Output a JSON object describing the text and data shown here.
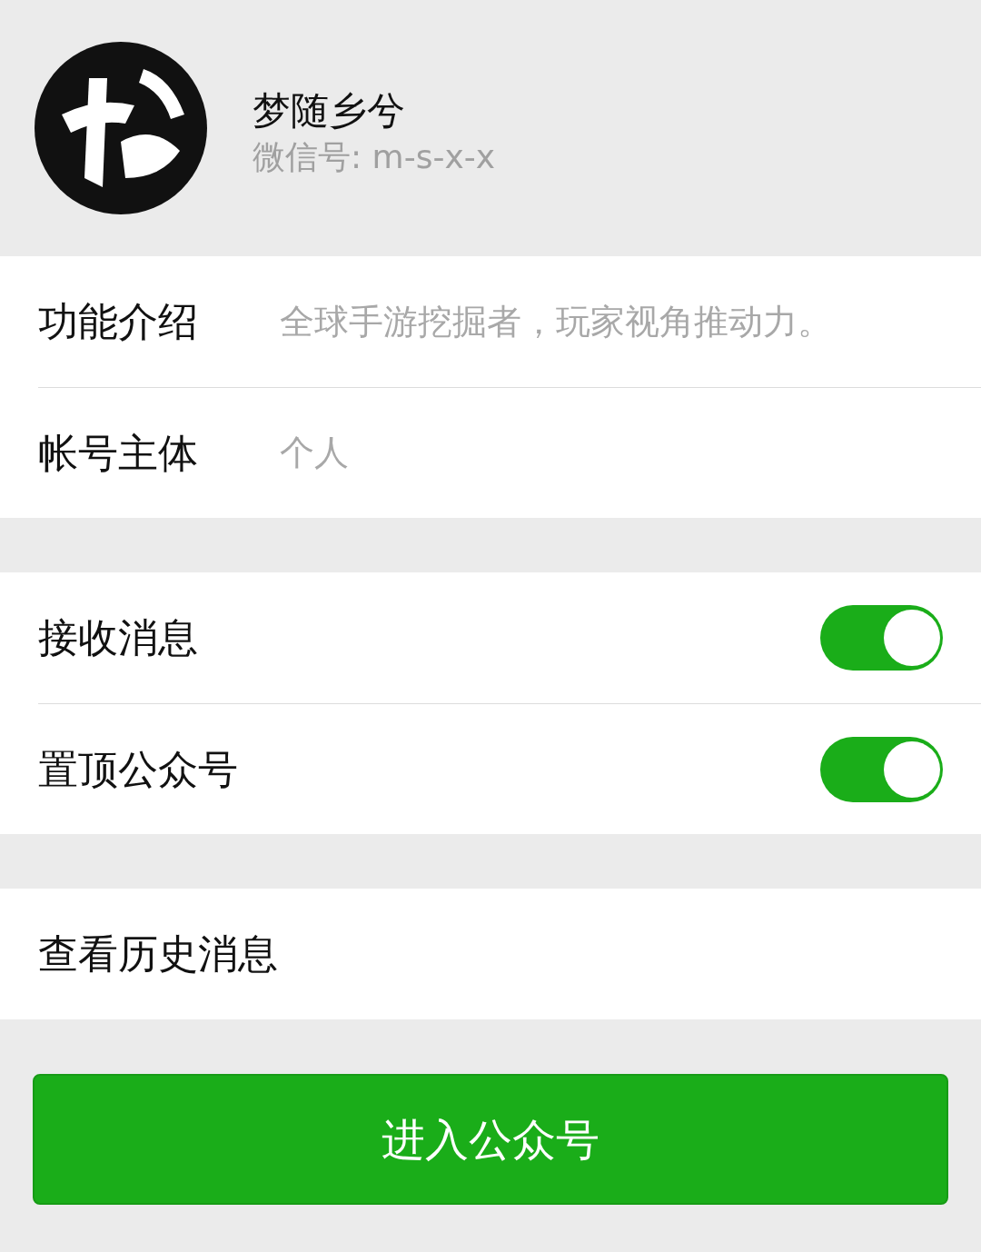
{
  "profile": {
    "name": "梦随乡兮",
    "wechat_id": "微信号: m-s-x-x"
  },
  "info_rows": [
    {
      "label": "功能介绍",
      "value": "全球手游挖掘者，玩家视角推动力。"
    },
    {
      "label": "帐号主体",
      "value": "个人"
    }
  ],
  "settings": [
    {
      "label": "接收消息",
      "on": true
    },
    {
      "label": "置顶公众号",
      "on": true
    }
  ],
  "history": {
    "label": "查看历史消息"
  },
  "enter_button": {
    "label": "进入公众号"
  }
}
